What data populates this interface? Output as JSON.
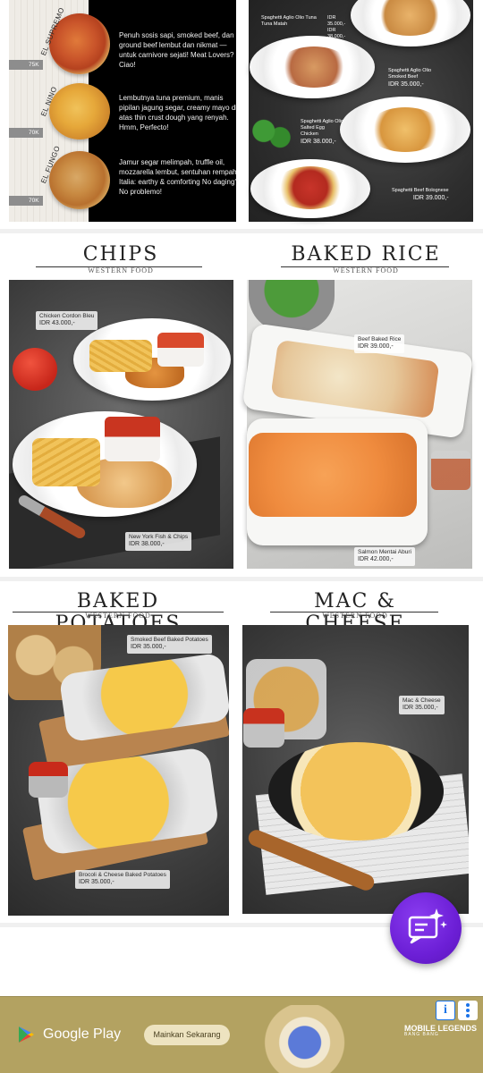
{
  "pizza": {
    "items": [
      {
        "name": "EL SUPREMO",
        "desc": "Penuh sosis sapi, smoked beef, dan ground beef lembut dan nikmat —untuk carnivore sejati! Meat Lovers? Ciao!",
        "price": "75K"
      },
      {
        "name": "EL NINO",
        "desc": "Lembutnya tuna premium, manis pipilan jagung segar, creamy mayo di atas thin crust dough yang renyah. Hmm, Perfecto!",
        "price": "70K"
      },
      {
        "name": "EL FUNGO",
        "desc": "Jamur segar melimpah, truffle oil, mozzarella lembut, sentuhan rempah Italia: earthy & comforting No daging? No problemo!",
        "price": "70K"
      }
    ]
  },
  "pasta": {
    "items": [
      {
        "name": "Spaghetti Aglio Olio Tuna Tuna Matah",
        "price": "IDR 35.000,- IDR 38.000,-"
      },
      {
        "name": "Spaghetti Aglio Olio Smoked Beef",
        "price": "IDR 35.000,-"
      },
      {
        "name": "Spaghetti Aglio Olio Salted Egg Chicken",
        "price": "IDR 38.000,-"
      },
      {
        "name": "Spaghetti Beef Bolognese",
        "price": "IDR 39.000,-"
      }
    ]
  },
  "sections": {
    "chips": {
      "title": "CHIPS",
      "subtitle": "WESTERN FOOD",
      "items": [
        {
          "name": "Chicken Cordon Bleu",
          "price": "IDR 43.000,-"
        },
        {
          "name": "New York Fish & Chips",
          "price": "IDR 38.000,-"
        }
      ]
    },
    "baked_rice": {
      "title": "BAKED RICE",
      "subtitle": "WESTERN FOOD",
      "items": [
        {
          "name": "Beef Baked Rice",
          "price": "IDR 39.000,-"
        },
        {
          "name": "Salmon Mentai Aburi",
          "price": "IDR 42.000,-"
        }
      ]
    },
    "baked_potatoes": {
      "title": "BAKED POTATOES",
      "subtitle": "WESTERN FOOD",
      "items": [
        {
          "name": "Smoked Beef Baked Potatoes",
          "price": "IDR 35.000,-"
        },
        {
          "name": "Brocoli & Cheese Baked Potatoes",
          "price": "IDR 35.000,-"
        }
      ]
    },
    "mac_cheese": {
      "title": "MAC & CHEESE",
      "subtitle": "WESTERN FOOD",
      "items": [
        {
          "name": "Mac & Cheese",
          "price": "IDR 35.000,-"
        }
      ]
    }
  },
  "ad": {
    "store": "Google Play",
    "cta": "Mainkan Sekarang",
    "game": "MOBILE LEGENDS",
    "game_sub": "BANG BANG",
    "info": "i"
  },
  "colors": {
    "fab": "#6c1fd6",
    "ad_bg": "#b3a261"
  },
  "icons": {
    "fab": "ai-chat-sparkle-icon",
    "info": "info-icon",
    "more": "kebab-menu-icon",
    "store": "google-play-icon"
  }
}
